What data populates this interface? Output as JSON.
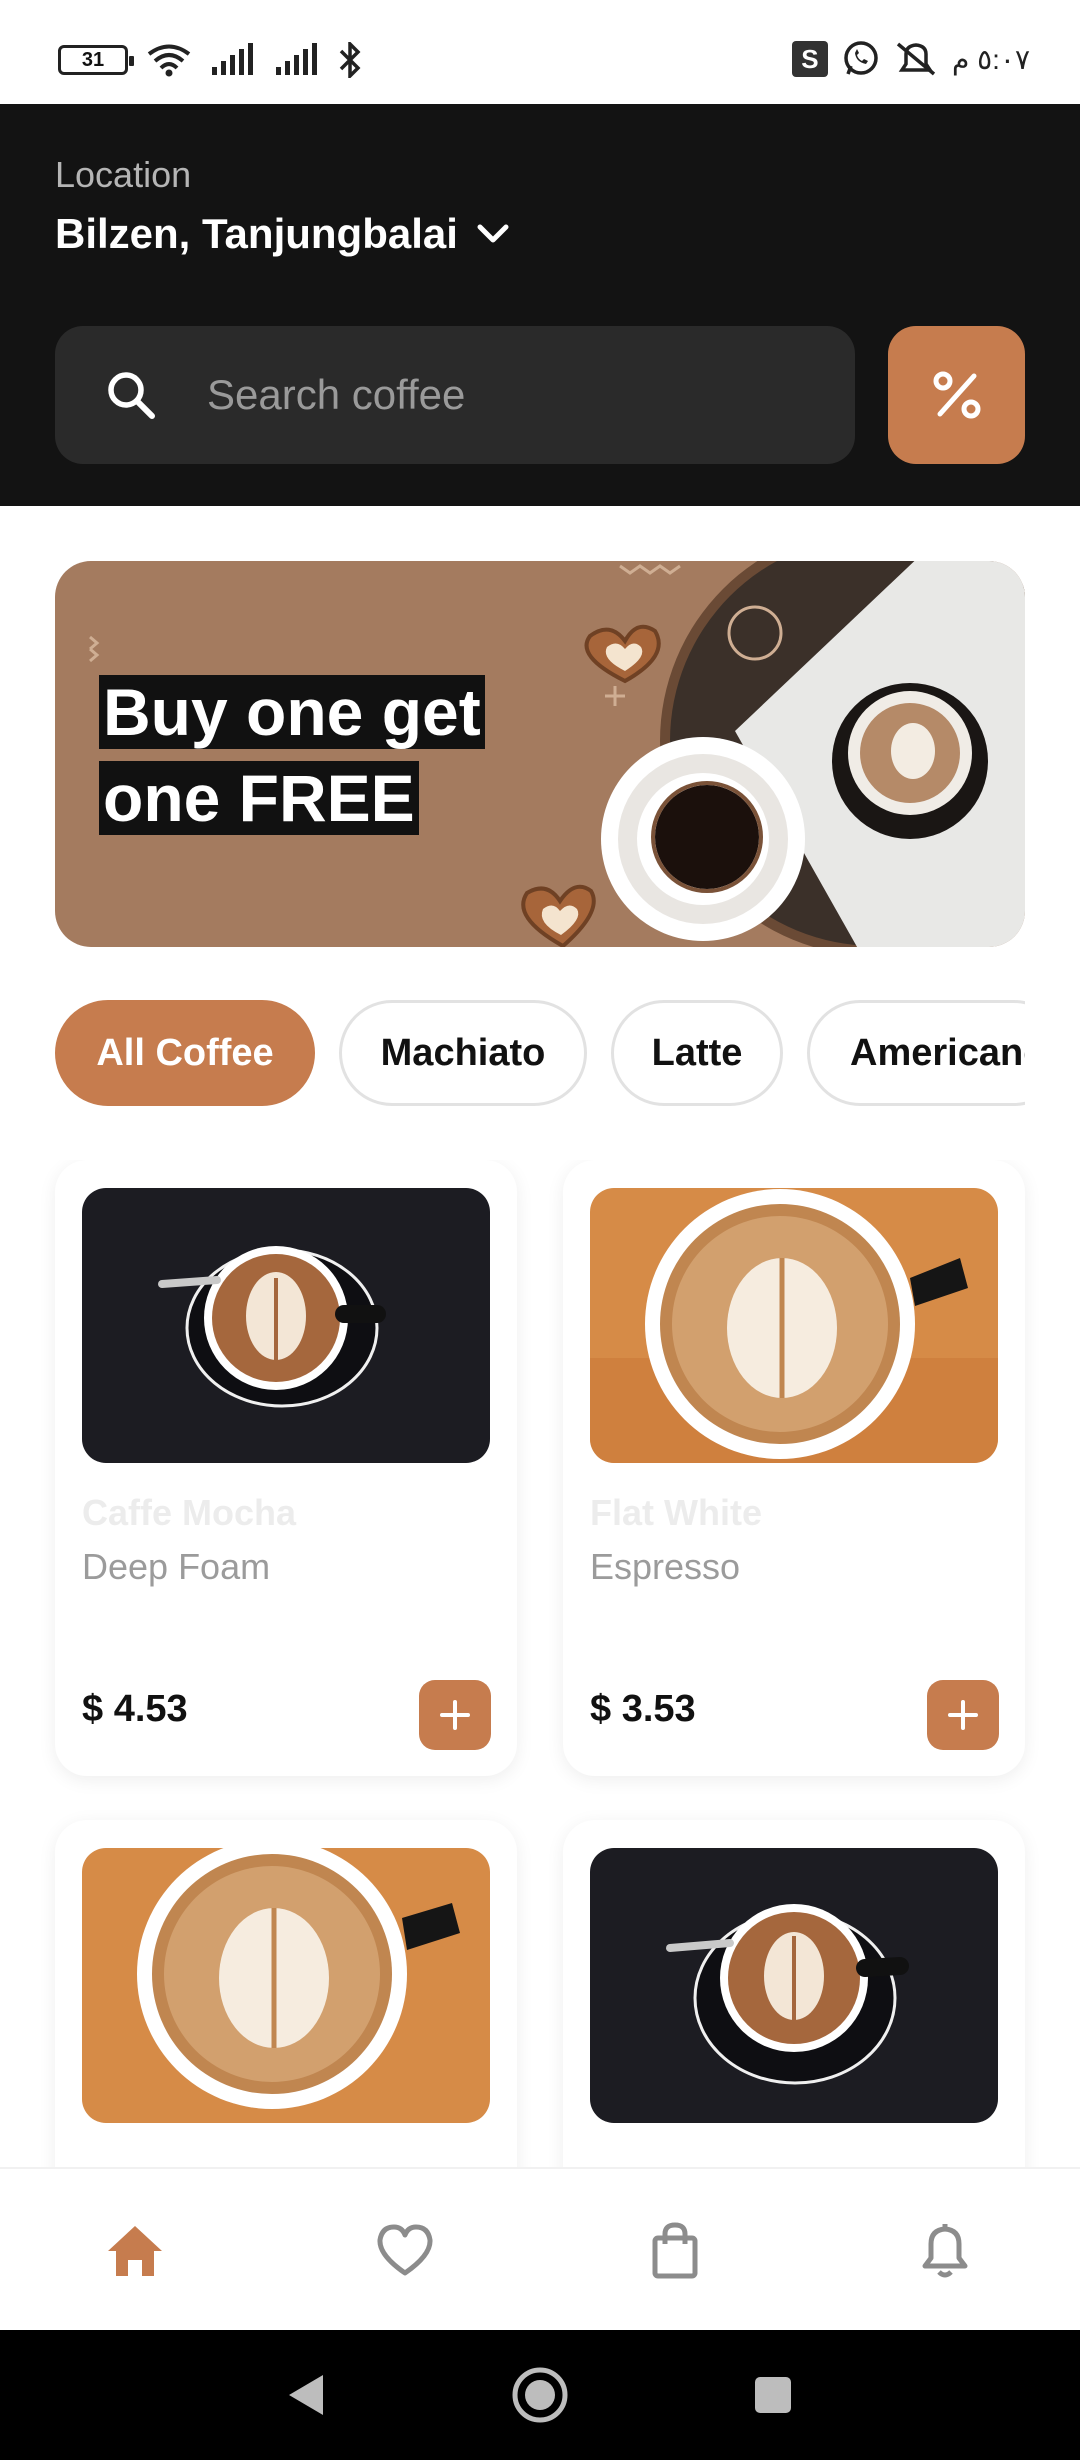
{
  "status_bar": {
    "battery": "31",
    "time": "٥:٠٧ م",
    "icons": [
      "battery-icon",
      "wifi-icon",
      "signal-icon",
      "signal-icon",
      "bluetooth-icon",
      "s-app-icon",
      "whatsapp-icon",
      "muted-icon"
    ]
  },
  "header": {
    "location_label": "Location",
    "location_value": "Bilzen, Tanjungbalai",
    "search_placeholder": "Search coffee",
    "filter_icon": "percent-icon"
  },
  "promo": {
    "line1": "Buy one get",
    "line2": "one FREE"
  },
  "categories": [
    {
      "label": "All Coffee",
      "active": true
    },
    {
      "label": "Machiato",
      "active": false
    },
    {
      "label": "Latte",
      "active": false
    },
    {
      "label": "Americano",
      "active": false
    }
  ],
  "products": [
    {
      "name": "Caffe Mocha",
      "subtitle": "Deep Foam",
      "price": "$ 4.53",
      "photo": "dark-latte"
    },
    {
      "name": "Flat White",
      "subtitle": "Espresso",
      "price": "$ 3.53",
      "photo": "wood-latte"
    },
    {
      "name": "",
      "subtitle": "",
      "price": "",
      "photo": "wood-latte"
    },
    {
      "name": "",
      "subtitle": "",
      "price": "",
      "photo": "dark-latte"
    }
  ],
  "bottom_nav": [
    {
      "icon": "home-icon",
      "active": true
    },
    {
      "icon": "heart-icon",
      "active": false
    },
    {
      "icon": "shopping-bag-icon",
      "active": false
    },
    {
      "icon": "bell-icon",
      "active": false
    }
  ],
  "colors": {
    "accent": "#c67c4e",
    "header_bg": "#131313",
    "promo_bg": "#a47b5f"
  }
}
